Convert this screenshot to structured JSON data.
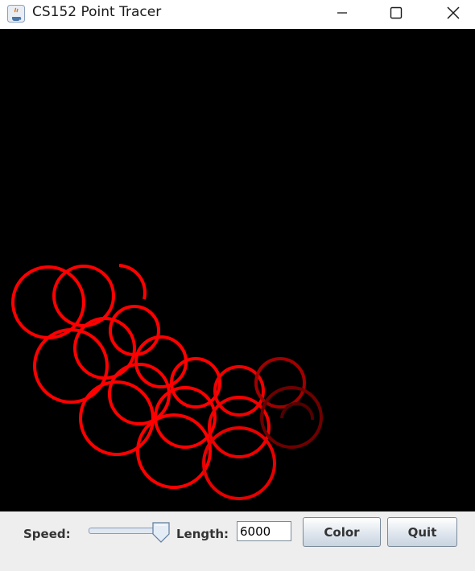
{
  "window": {
    "title": "CS152 Point Tracer",
    "icon": "java-icon"
  },
  "canvas": {
    "background": "#000000",
    "trace_color": "#ff0000"
  },
  "controls": {
    "speed_label": "Speed:",
    "speed_slider_fraction": 0.92,
    "length_label": "Length:",
    "length_value": "6000",
    "color_button": "Color",
    "quit_button": "Quit"
  }
}
